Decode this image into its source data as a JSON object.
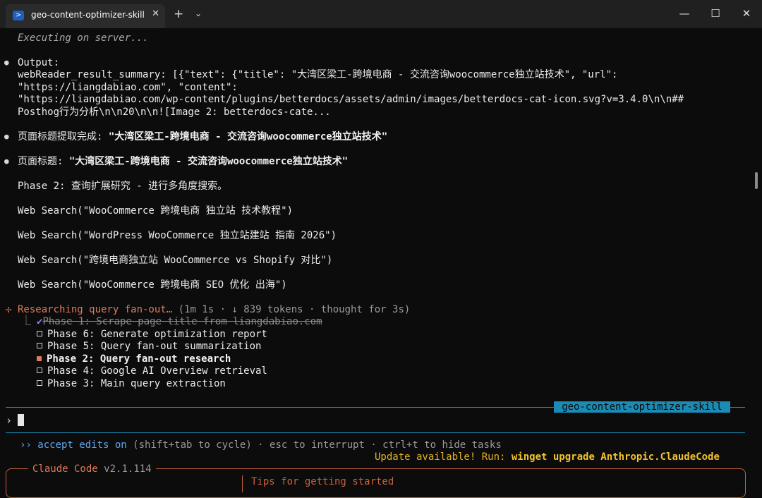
{
  "window": {
    "tab_title": "geo-content-optimizer-skill",
    "tab_icon": "powershell-icon",
    "controls": {
      "minimize": "—",
      "maximize": "☐",
      "close": "✕",
      "new_tab": "+",
      "dropdown": "⌄",
      "tab_close": "✕"
    }
  },
  "terminal": {
    "executing": "Executing on server...",
    "output_label": "Output:",
    "output_lines": [
      "webReader_result_summary: [{\"text\": {\"title\": \"大湾区梁工-跨境电商 - 交流咨询woocommerce独立站技术\", \"url\":",
      "\"https://liangdabiao.com\", \"content\":",
      "\"https://liangdabiao.com/wp-content/plugins/betterdocs/assets/admin/images/betterdocs-cat-icon.svg?v=3.4.0\\n\\n##",
      "Posthog行为分析\\n\\n20\\n\\n![Image 2: betterdocs-cate..."
    ],
    "title_extract_label": "页面标题提取完成: ",
    "title_extract_value": "\"大湾区梁工-跨境电商 - 交流咨询woocommerce独立站技术\"",
    "title_label": "页面标题: ",
    "title_value": "\"大湾区梁工-跨境电商 - 交流咨询woocommerce独立站技术\"",
    "phase2": "Phase 2: 查询扩展研究 - 进行多角度搜索。",
    "searches": [
      "Web Search(\"WooCommerce 跨境电商 独立站 技术教程\")",
      "Web Search(\"WordPress WooCommerce 独立站建站 指南 2026\")",
      "Web Search(\"跨境电商独立站 WooCommerce vs Shopify 对比\")",
      "Web Search(\"WooCommerce 跨境电商 SEO 优化 出海\")"
    ],
    "status_icon": "✢",
    "status_text": "Researching query fan-out…",
    "status_meta": "(1m 1s · ↓ 839 tokens · thought for 3s)",
    "tasks": [
      {
        "label": "Phase 1: Scrape page title from liangdabiao.com",
        "state": "done"
      },
      {
        "label": "Phase 6: Generate optimization report",
        "state": "pending"
      },
      {
        "label": "Phase 5: Query fan-out summarization",
        "state": "pending"
      },
      {
        "label": "Phase 2: Query fan-out research",
        "state": "active"
      },
      {
        "label": "Phase 4: Google AI Overview retrieval",
        "state": "pending"
      },
      {
        "label": "Phase 3: Main query extraction",
        "state": "pending"
      }
    ],
    "session_tag": "geo-content-optimizer-skill",
    "prompt_symbol": "›",
    "mode_arrows": "››",
    "mode_text": "accept edits on",
    "mode_hint": "(shift+tab to cycle) · esc to interrupt · ctrl+t to hide tasks",
    "update_prefix": "Update available! Run: ",
    "update_command": "winget upgrade Anthropic.ClaudeCode",
    "app_name": "Claude Code",
    "app_version": "v2.1.114",
    "tips_label": "Tips for getting started"
  },
  "colors": {
    "background": "#0c0c0c",
    "accent_orange": "#e0785a",
    "accent_cyan": "#1a8bb5",
    "accent_blue": "#5fa8f0",
    "update_yellow": "#e6b422",
    "check_purple": "#9b7cf2"
  }
}
